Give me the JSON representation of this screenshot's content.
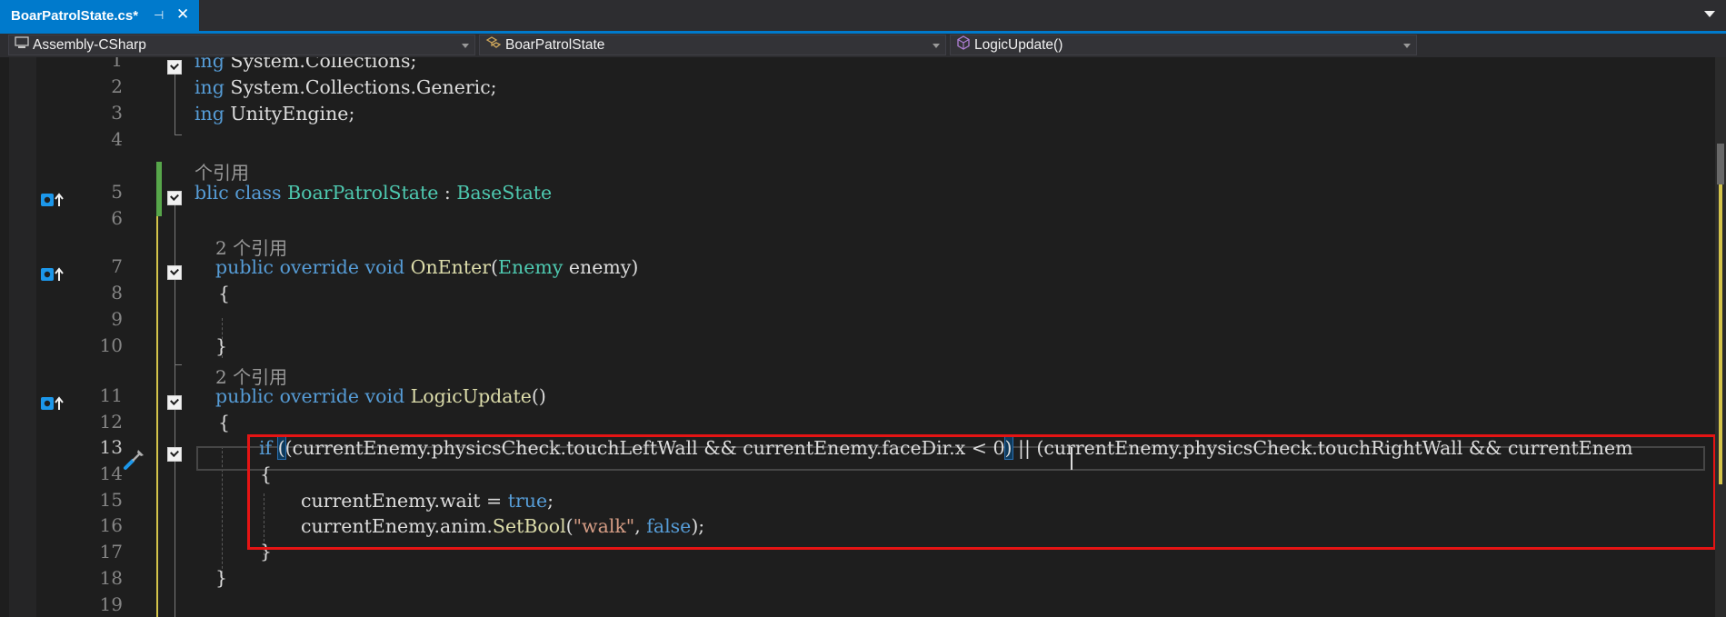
{
  "tab": {
    "title": "BoarPatrolState.cs*",
    "pin_glyph": "⊣",
    "close_glyph": "✕"
  },
  "navbar": {
    "project": "Assembly-CSharp",
    "type": "BoarPatrolState",
    "member": "LogicUpdate()"
  },
  "line_numbers": [
    "1",
    "2",
    "3",
    "4",
    "5",
    "6",
    "7",
    "8",
    "9",
    "10",
    "11",
    "12",
    "13",
    "14",
    "15",
    "16",
    "17",
    "18",
    "19"
  ],
  "code": {
    "l1": [
      "ing ",
      "System.Collections;"
    ],
    "l2": [
      "ing ",
      "System.Collections.Generic;"
    ],
    "l3": [
      "ing ",
      "UnityEngine;"
    ],
    "refs_class": "个引用",
    "l5": [
      "blic ",
      "class ",
      "BoarPatrolState",
      " : ",
      "BaseState"
    ],
    "refs_onenter": "2 个引用",
    "l7": [
      "public ",
      "override ",
      "void ",
      "OnEnter",
      "(",
      "Enemy",
      " enemy)"
    ],
    "l8": "{",
    "l10": "}",
    "refs_logic": "2 个引用",
    "l11": [
      "public ",
      "override ",
      "void ",
      "LogicUpdate",
      "()"
    ],
    "l12": "{",
    "l13": [
      "if ",
      "(",
      "(currentEnemy.physicsCheck.touchLeftWall && currentEnemy.faceDir.x < 0",
      ")",
      " || ",
      "(currentEnemy.physicsCheck.touchRightWall && currentEnem"
    ],
    "l14": "{",
    "l15": [
      "currentEnemy.wait = ",
      "true",
      ";"
    ],
    "l16": [
      "currentEnemy.anim.",
      "SetBool",
      "(",
      "\"walk\"",
      ", ",
      "false",
      ");"
    ],
    "l17": "}",
    "l18": "}"
  },
  "colors": {
    "keyword": "#569cd6",
    "type": "#4ec9b0",
    "method": "#dcdcaa",
    "string": "#d69d85",
    "accent": "#007acc",
    "highlight_box": "#e51414"
  },
  "icons": {
    "tab_pin": "pin-icon",
    "tab_close": "close-icon",
    "project": "project-icon",
    "type": "class-icon",
    "member": "method-icon",
    "override": "override-icon",
    "screwdriver": "quick-actions-icon"
  }
}
